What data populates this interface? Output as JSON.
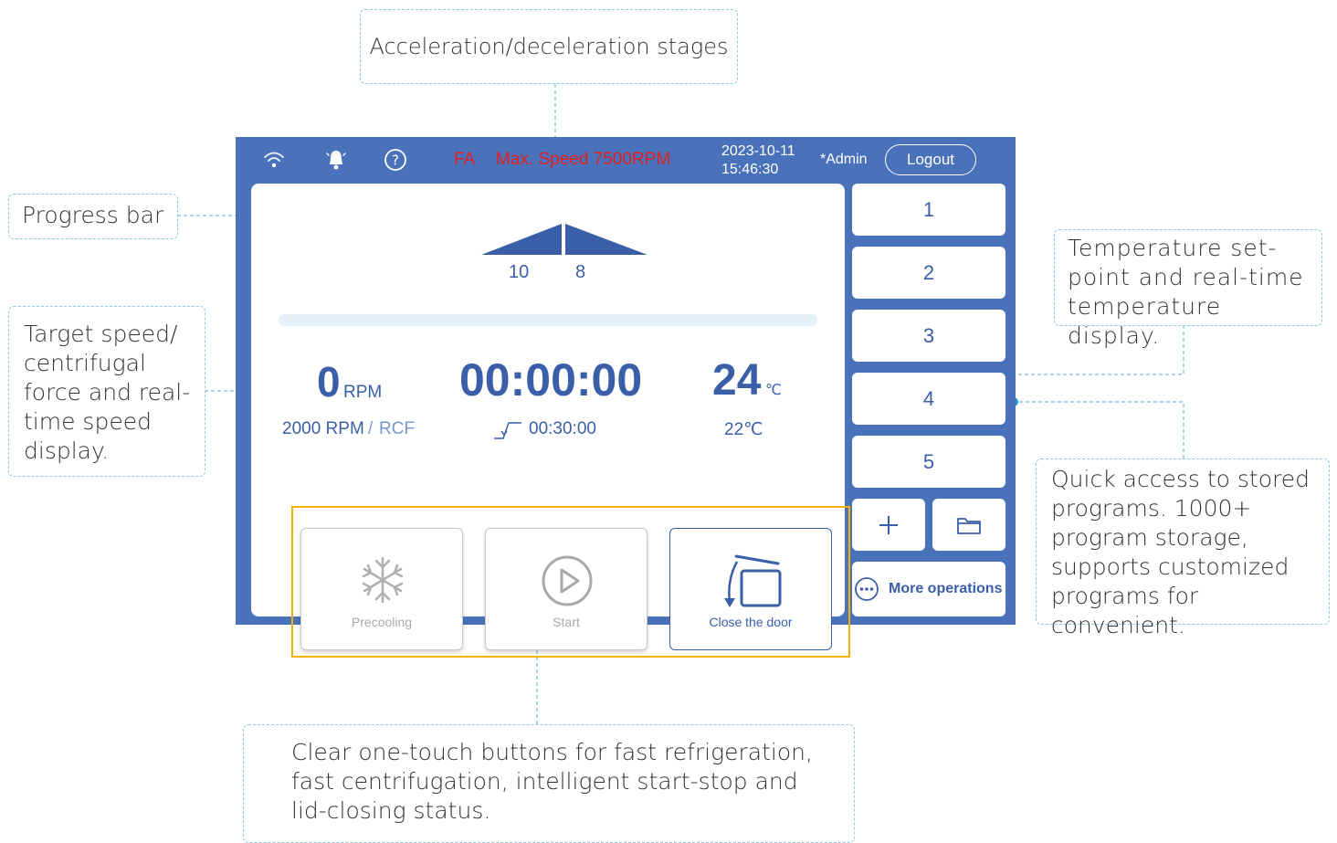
{
  "callouts": {
    "accel": "Acceleration/deceleration stages",
    "progress": "Progress bar",
    "speed": "Target speed/ centrifugal force and real-time speed display.",
    "temperature": "Temperature set-point and real-time temperature display.",
    "programs": "Quick access to stored programs. 1000+ program storage, supports customized programs for convenient.",
    "buttons": "Clear one-touch buttons for fast refrigeration, fast centrifugation, intelligent start-stop and lid-closing status."
  },
  "topbar": {
    "icons": [
      "wifi-icon",
      "bell-icon",
      "help-icon"
    ],
    "rotor_code": "FA",
    "max_speed": "Max. Speed 7500RPM",
    "date": "2023-10-11",
    "time": "15:46:30",
    "user": "*Admin",
    "logout_label": "Logout"
  },
  "stages": {
    "acceleration": "10",
    "deceleration": "8"
  },
  "progress": {
    "value": 0
  },
  "speed": {
    "value": "0",
    "unit": "RPM",
    "target": "2000 RPM",
    "sep": "/",
    "mode": "RCF"
  },
  "timer": {
    "elapsed": "00:00:00",
    "set": "00:30:00"
  },
  "temperature": {
    "current": "24",
    "unit": "℃",
    "set": "22℃"
  },
  "actions": [
    {
      "label": "Precooling",
      "icon": "snowflake-icon",
      "enabled": false
    },
    {
      "label": "Start",
      "icon": "play-icon",
      "enabled": false
    },
    {
      "label": "Close the door",
      "icon": "door-icon",
      "enabled": true
    }
  ],
  "programs": [
    "1",
    "2",
    "3",
    "4",
    "5"
  ],
  "program_tools": {
    "add_icon": "plus-icon",
    "folder_icon": "folder-icon"
  },
  "more_operations_label": "More operations",
  "colors": {
    "panel": "#4a72bb",
    "text_blue": "#3a5ea8",
    "alert": "#e02020",
    "highlight": "#f0b400",
    "callout_border": "#8cc9e3",
    "dot": "#1a9be0"
  }
}
